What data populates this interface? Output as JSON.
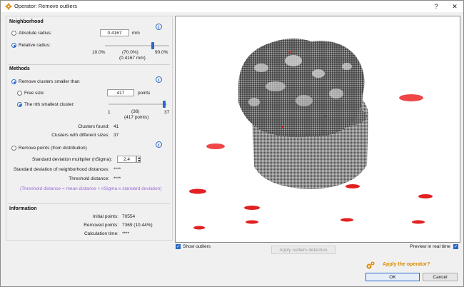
{
  "window": {
    "title": "Operator: Remove outliers",
    "help": "?",
    "close": "✕"
  },
  "neighborhood": {
    "heading": "Neighborhood",
    "absolute_label": "Absolute radius:",
    "absolute_value": "0.4167",
    "absolute_unit": "mm",
    "relative_label": "Relative radius:",
    "slider_min": "10.0%",
    "slider_max": "90.0%",
    "slider_value": "(70.0%)",
    "slider_value_mm": "(0.4167 mm)",
    "slider_fraction": 0.75
  },
  "methods": {
    "heading": "Methods",
    "remove_clusters_label": "Remove clusters smaller than",
    "free_size_label": "Free size:",
    "free_size_value": "417",
    "free_size_unit": "points",
    "nth_label": "The nth smallest cluster:",
    "nth_min": "1",
    "nth_max": "37",
    "nth_value": "(36)",
    "nth_points": "(417 points)",
    "nth_fraction": 0.97,
    "clusters_found_label": "Clusters found:",
    "clusters_found_value": "41",
    "clusters_diff_label": "Clusters with different sizes:",
    "clusters_diff_value": "37",
    "remove_points_label": "Remove points (from distribution)",
    "sigma_label": "Standard deviation multiplier (nSigma):",
    "sigma_value": "2.4",
    "std_label": "Standard deviation of neighborhood distances:",
    "std_value": "****",
    "threshold_label": "Threshold distance:",
    "threshold_value": "****",
    "formula": "(Threshold distance = mean distance + nSigma x standard deviation)"
  },
  "information": {
    "heading": "Information",
    "initial_label": "Initial points:",
    "initial_value": "70554",
    "removed_label": "Removed points:",
    "removed_value": "7369 (10.44%)",
    "calc_label": "Calculation time:",
    "calc_value": "****"
  },
  "viewport": {
    "show_outliers_label": "Show outliers",
    "preview_label": "Preview in real time",
    "detect_button": "Apply outliers detection"
  },
  "footer": {
    "apply_question": "Apply the operator?",
    "ok": "OK",
    "cancel": "Cancel"
  },
  "colors": {
    "accent": "#2a69c8",
    "outlier": "#e02020",
    "apply": "#d98a00",
    "formula": "#9a6ad6"
  }
}
